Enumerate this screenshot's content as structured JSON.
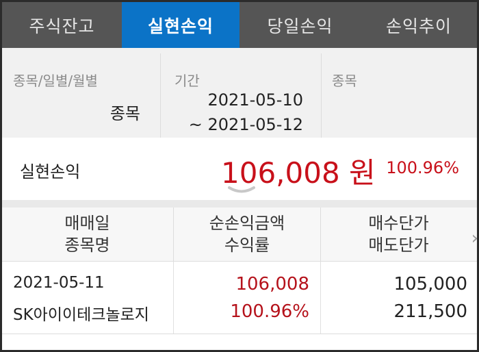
{
  "tabs": [
    {
      "label": "주식잔고",
      "active": false
    },
    {
      "label": "실현손익",
      "active": true
    },
    {
      "label": "당일손익",
      "active": false
    },
    {
      "label": "손익추이",
      "active": false
    }
  ],
  "filter": {
    "type_label": "종목/일별/월별",
    "type_value": "종목",
    "period_label": "기간",
    "period_from": "2021-05-10",
    "period_to": "~ 2021-05-12",
    "stock_label": "종목"
  },
  "summary": {
    "label": "실현손익",
    "amount": "106,008 원",
    "rate": "100.96%"
  },
  "table": {
    "headers": [
      {
        "line1": "매매일",
        "line2": "종목명"
      },
      {
        "line1": "순손익금액",
        "line2": "수익률"
      },
      {
        "line1": "매수단가",
        "line2": "매도단가"
      }
    ],
    "rows": [
      {
        "date": "2021-05-11",
        "name": "SK아이이테크놀로지",
        "profit": "106,008",
        "rate": "100.96%",
        "buy_price": "105,000",
        "sell_price": "211,500"
      }
    ]
  },
  "colors": {
    "active_tab": "#0b73c7",
    "tab_bar": "#555555",
    "profit_red": "#c8101a"
  }
}
